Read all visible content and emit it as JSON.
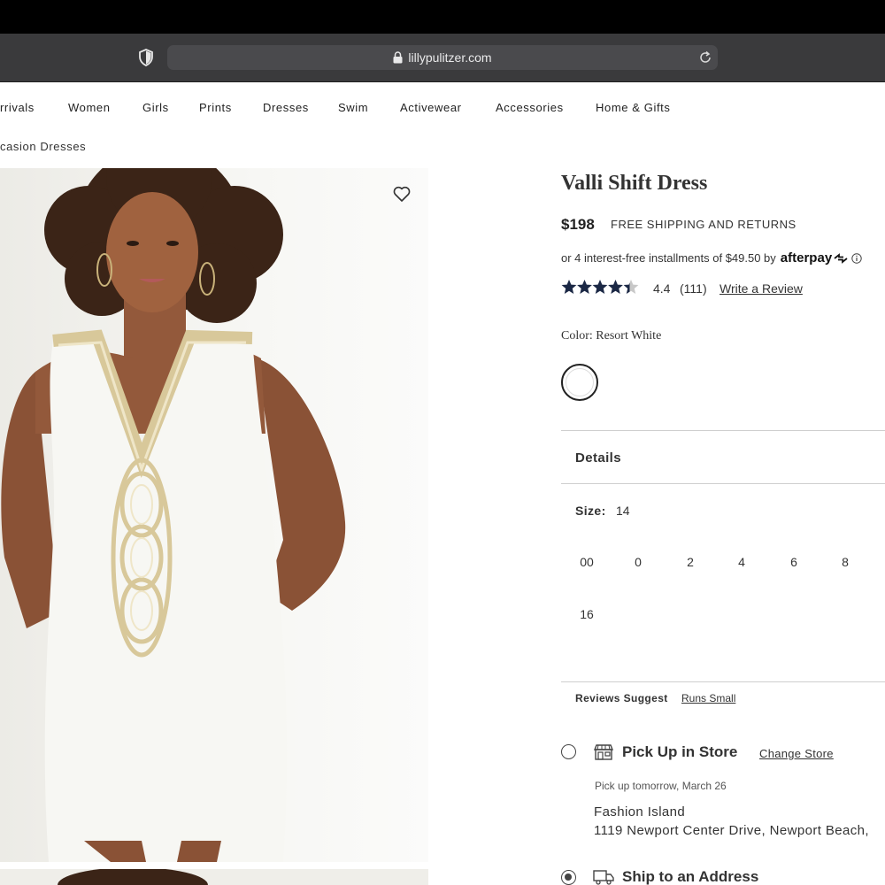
{
  "browser": {
    "url": "lillypulitzer.com"
  },
  "nav": {
    "items": [
      "rrivals",
      "Women",
      "Girls",
      "Prints",
      "Dresses",
      "Swim",
      "Activewear",
      "Accessories",
      "Home & Gifts"
    ]
  },
  "breadcrumb": "casion Dresses",
  "product": {
    "title": "Valli Shift Dress",
    "price": "$198",
    "shipping_note": "FREE SHIPPING AND RETURNS",
    "installments_text": "or 4 interest-free installments of $49.50 by",
    "afterpay_brand": "afterpay",
    "rating": 4.4,
    "rating_text": "4.4",
    "review_count": "(111)",
    "write_review": "Write a Review",
    "color_label": "Color: Resort White",
    "details_label": "Details",
    "size_label": "Size:",
    "size_selected": "14",
    "sizes": [
      "00",
      "0",
      "2",
      "4",
      "6",
      "8",
      "16"
    ],
    "reviews_suggest_label": "Reviews Suggest",
    "reviews_suggest_value": "Runs Small"
  },
  "fulfillment": {
    "pickup": {
      "title": "Pick Up in Store",
      "change_store": "Change Store",
      "date": "Pick up tomorrow, March 26",
      "store_name": "Fashion Island",
      "store_address": "1119 Newport Center Drive, Newport Beach,",
      "selected": false
    },
    "ship": {
      "title": "Ship to an Address",
      "selected": true
    }
  },
  "colors": {
    "toolbar": "#3a3a3c",
    "star": "#1b2845",
    "dress": "#f7f7f3",
    "trim": "#d8c89a"
  },
  "icons": {
    "shield": "shield-icon",
    "lock": "lock-icon",
    "reload": "reload-icon",
    "favorite": "heart-icon",
    "store": "store-icon",
    "truck": "truck-icon",
    "info": "info-icon"
  }
}
